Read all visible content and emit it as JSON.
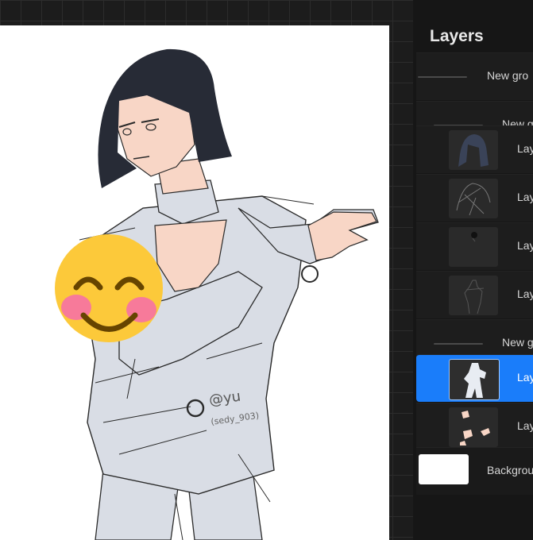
{
  "panel": {
    "title": "Layers",
    "layers": [
      {
        "kind": "group",
        "label": "New gro"
      },
      {
        "kind": "group",
        "label": "New g"
      },
      {
        "kind": "layer",
        "label": "Lay",
        "thumb": "hair-thumbnail-icon"
      },
      {
        "kind": "layer",
        "label": "Lay",
        "thumb": "sketch-thumbnail-icon"
      },
      {
        "kind": "layer",
        "label": "Lay",
        "thumb": "small-mark-thumbnail-icon"
      },
      {
        "kind": "layer",
        "label": "Lay",
        "thumb": "figure-sketch-thumbnail-icon"
      },
      {
        "kind": "group",
        "label": "New g"
      },
      {
        "kind": "layer",
        "label": "Lay",
        "selected": true,
        "thumb": "silhouette-thumbnail-icon"
      },
      {
        "kind": "layer",
        "label": "Lay",
        "thumb": "skin-patches-thumbnail-icon"
      },
      {
        "kind": "background",
        "label": "Backgrou"
      }
    ]
  },
  "canvas": {
    "signature": [
      "@yu",
      "(sedy_903)"
    ],
    "emoji": "smiling-face-icon"
  },
  "colors": {
    "accent": "#1a7dfa",
    "suit": "#d9dde5",
    "hair": "#272b36",
    "skin": "#f8d6c6"
  }
}
